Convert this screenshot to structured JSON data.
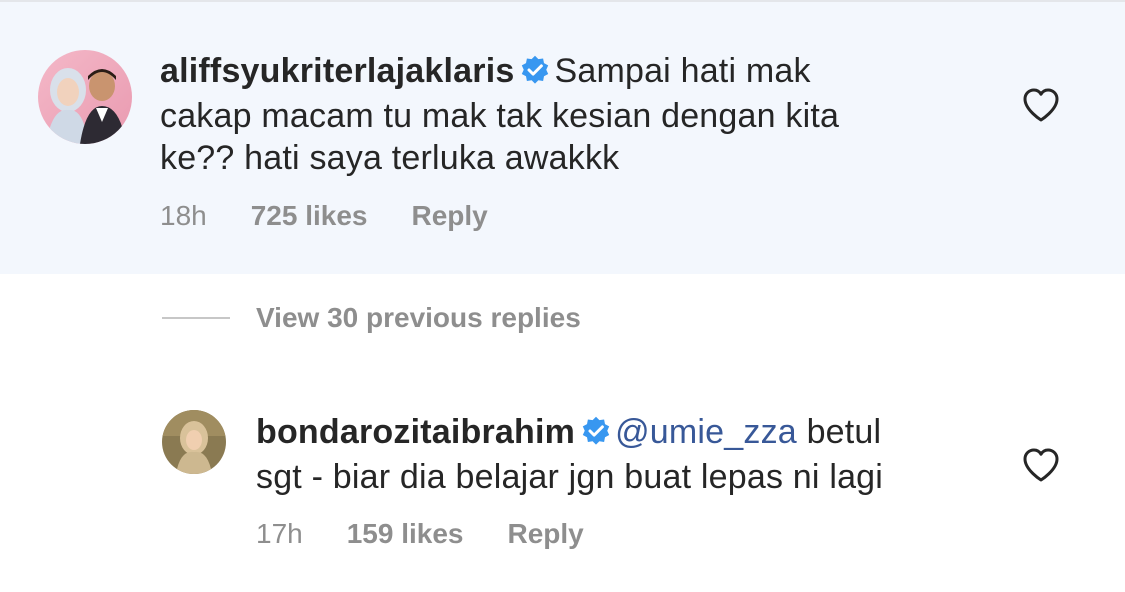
{
  "comment": {
    "username": "aliffsyukriterlajaklaris",
    "verified": true,
    "text_line1": "Sampai hati mak",
    "text_line2": "cakap macam tu mak tak kesian dengan kita",
    "text_line3": "ke?? hati saya terluka awakkk",
    "time": "18h",
    "likes": "725 likes",
    "reply_label": "Reply",
    "like_icon": "heart-outline-icon"
  },
  "view_replies": {
    "label": "View 30 previous replies"
  },
  "reply": {
    "username": "bondarozitaibrahim",
    "verified": true,
    "mention": "@umie_zza",
    "text_line1": "betul",
    "text_line2": "sgt - biar dia belajar jgn buat lepas ni lagi",
    "time": "17h",
    "likes": "159 likes",
    "reply_label": "Reply",
    "like_icon": "heart-outline-icon"
  },
  "colors": {
    "highlight_bg": "#f3f7fd",
    "verified_blue": "#3897f0",
    "mention_blue": "#385898",
    "meta_gray": "#8e8e8e",
    "text": "#262626"
  }
}
